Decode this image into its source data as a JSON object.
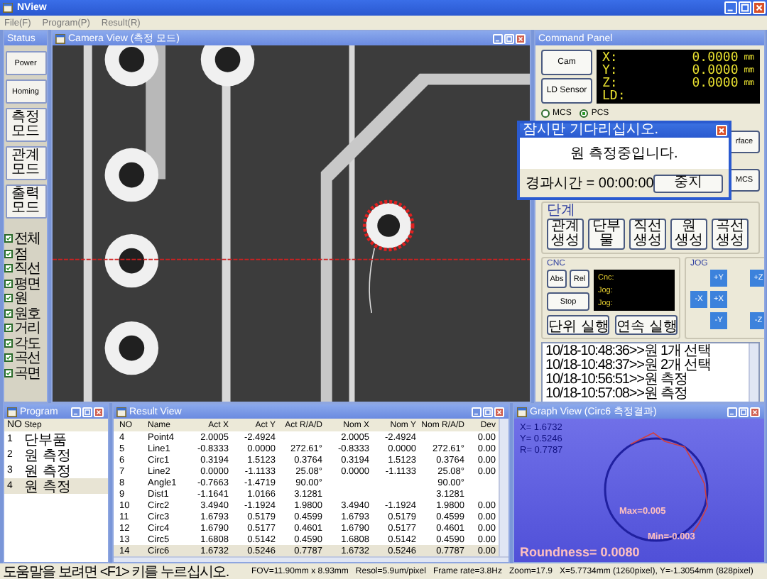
{
  "window": {
    "title": "NView"
  },
  "menu": [
    {
      "label": "File(F)"
    },
    {
      "label": "Program(P)"
    },
    {
      "label": "Result(R)"
    }
  ],
  "status_panel": {
    "title": "Status",
    "buttons": [
      {
        "label": "Power"
      },
      {
        "label": "Homing"
      },
      {
        "label": "측정 모드"
      },
      {
        "label": "관계 모드"
      },
      {
        "label": "출력 모드"
      }
    ],
    "filters": [
      {
        "label": "전체",
        "checked": true
      },
      {
        "label": "점",
        "checked": true
      },
      {
        "label": "직선",
        "checked": true
      },
      {
        "label": "평면",
        "checked": true
      },
      {
        "label": "원",
        "checked": true
      },
      {
        "label": "원호",
        "checked": true
      },
      {
        "label": "거리",
        "checked": true
      },
      {
        "label": "각도",
        "checked": true
      },
      {
        "label": "곡선",
        "checked": true
      },
      {
        "label": "곡면",
        "checked": true
      }
    ]
  },
  "camera_view": {
    "title": "Camera View (측정 모드)"
  },
  "command_panel": {
    "title": "Command Panel",
    "buttons": [
      "Cam",
      "LD Sensor"
    ],
    "readouts": [
      {
        "axis": "X:",
        "value": "0.0000",
        "unit": "mm"
      },
      {
        "axis": "Y:",
        "value": "0.0000",
        "unit": "mm"
      },
      {
        "axis": "Z:",
        "value": "0.0000",
        "unit": "mm"
      },
      {
        "axis": "LD:"
      }
    ],
    "coordinate_systems": [
      {
        "label": "MCS",
        "selected": false
      },
      {
        "label": "PCS",
        "selected": true
      }
    ],
    "side_buttons": [
      "rface",
      "MCS"
    ],
    "step_group": {
      "title": "단계",
      "buttons": [
        "관계 생성",
        "단부 물",
        "직선 생성",
        "원 생성",
        "곡선 생성"
      ]
    },
    "cnc": {
      "title": "CNC",
      "buttons": [
        "Abs",
        "Rel",
        "Stop"
      ],
      "display": [
        "Cnc:",
        "Jog:",
        "Jog:"
      ],
      "run_buttons": [
        "단위 실행",
        "연속 실행"
      ]
    },
    "jog": {
      "title": "JOG",
      "buttons": [
        "+Y",
        "+Z",
        "-X",
        "+X",
        "-Y",
        "-Z"
      ]
    },
    "log": [
      "10/18-10:48:36>>원 1개 선택",
      "10/18-10:48:37>>원 2개 선택",
      "10/18-10:56:51>>원 측정",
      "10/18-10:57:08>>원 측정"
    ]
  },
  "dialog": {
    "title": "잠시만 기다리십시오.",
    "message": "원 측정중입니다.",
    "elapsed": "경과시간 = 00:00:00",
    "button": "중지"
  },
  "program": {
    "title": "Program",
    "columns": [
      "NO",
      "Step"
    ],
    "rows": [
      {
        "cells": [
          "1",
          "단부품"
        ],
        "selected": false
      },
      {
        "cells": [
          "2",
          "원 측정"
        ],
        "selected": false
      },
      {
        "cells": [
          "3",
          "원 측정"
        ],
        "selected": false
      },
      {
        "cells": [
          "4",
          "원 측정"
        ],
        "selected": true
      }
    ]
  },
  "result_view": {
    "title": "Result View",
    "columns": [
      "NO",
      "Name",
      "Act X",
      "Act Y",
      "Act R/A/D",
      "Nom X",
      "Nom Y",
      "Nom R/A/D",
      "Dev"
    ],
    "rows": [
      {
        "cells": [
          "4",
          "Point4",
          "2.0005",
          "-2.4924",
          null,
          "2.0005",
          "-2.4924",
          null,
          "0.00"
        ],
        "selected": false
      },
      {
        "cells": [
          "5",
          "Line1",
          "-0.8333",
          "0.0000",
          "272.61°",
          "-0.8333",
          "0.0000",
          "272.61°",
          "0.00"
        ],
        "selected": false
      },
      {
        "cells": [
          "6",
          "Circ1",
          "0.3194",
          "1.5123",
          "0.3764",
          "0.3194",
          "1.5123",
          "0.3764",
          "0.00"
        ],
        "selected": false
      },
      {
        "cells": [
          "7",
          "Line2",
          "0.0000",
          "-1.1133",
          "25.08°",
          "0.0000",
          "-1.1133",
          "25.08°",
          "0.00"
        ],
        "selected": false
      },
      {
        "cells": [
          "8",
          "Angle1",
          "-0.7663",
          "-1.4719",
          "90.00°",
          null,
          null,
          "90.00°",
          null
        ],
        "selected": false
      },
      {
        "cells": [
          "9",
          "Dist1",
          "-1.1641",
          "1.0166",
          "3.1281",
          null,
          null,
          "3.1281",
          null
        ],
        "selected": false
      },
      {
        "cells": [
          "10",
          "Circ2",
          "3.4940",
          "-1.1924",
          "1.9800",
          "3.4940",
          "-1.1924",
          "1.9800",
          "0.00"
        ],
        "selected": false
      },
      {
        "cells": [
          "11",
          "Circ3",
          "1.6793",
          "0.5179",
          "0.4599",
          "1.6793",
          "0.5179",
          "0.4599",
          "0.00"
        ],
        "selected": false
      },
      {
        "cells": [
          "12",
          "Circ4",
          "1.6790",
          "0.5177",
          "0.4601",
          "1.6790",
          "0.5177",
          "0.4601",
          "0.00"
        ],
        "selected": false
      },
      {
        "cells": [
          "13",
          "Circ5",
          "1.6808",
          "0.5142",
          "0.4590",
          "1.6808",
          "0.5142",
          "0.4590",
          "0.00"
        ],
        "selected": false
      },
      {
        "cells": [
          "14",
          "Circ6",
          "1.6732",
          "0.5246",
          "0.7787",
          "1.6732",
          "0.5246",
          "0.7787",
          "0.00"
        ],
        "selected": true
      }
    ]
  },
  "graph_view": {
    "title": "Graph View (Circ6 측정결과)",
    "readouts": [
      "X= 1.6732",
      "Y= 0.5246",
      "R= 0.7787"
    ],
    "annotations": [
      "Max=0.005",
      "Min=-0.003"
    ],
    "roundness": "Roundness= 0.0080"
  },
  "status_bar": [
    "도움말을 보려면 <F1> 키를 누르십시오.",
    "FOV=11.90mm x 8.93mm",
    "Resol=5.9um/pixel",
    "Frame rate=3.8Hz",
    "Zoom=17.9",
    "X=5.7734mm (1260pixel), Y=-1.3054mm (828pixel)"
  ]
}
